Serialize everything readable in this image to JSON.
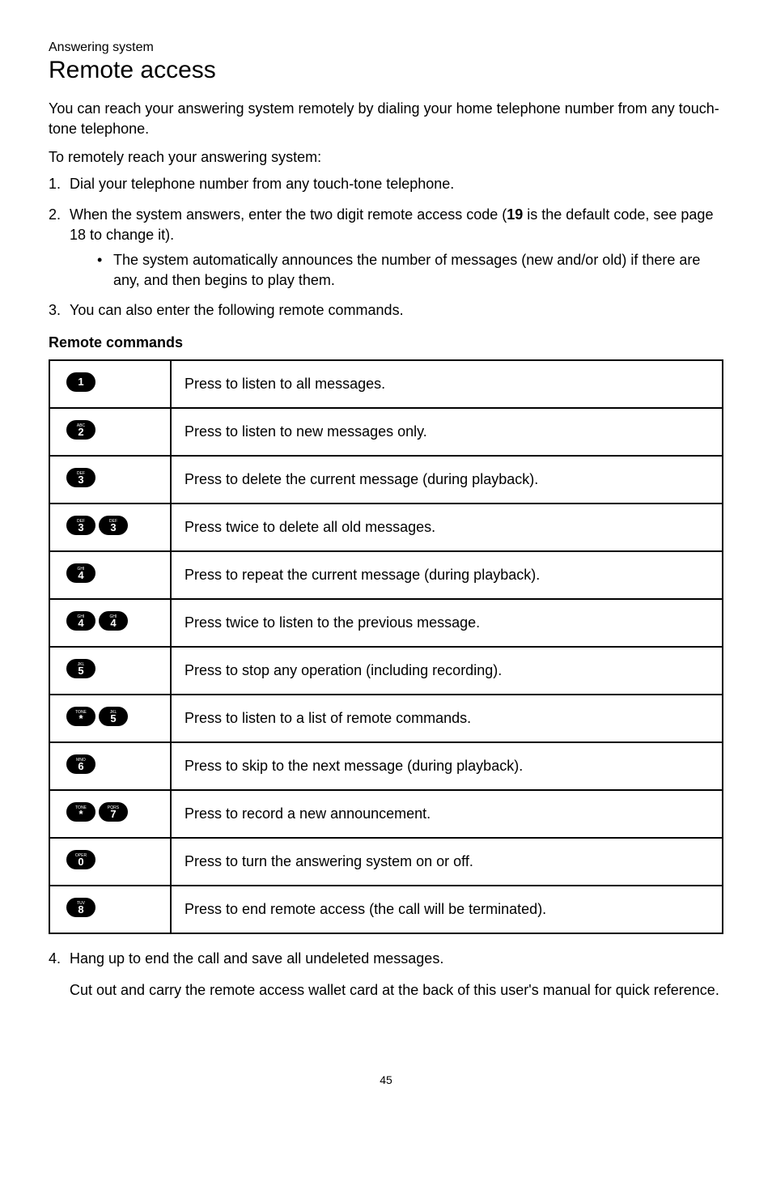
{
  "header": {
    "section_label": "Answering system",
    "title": "Remote access"
  },
  "intro": {
    "p1": "You can reach your answering system remotely by dialing your home telephone number from any touch-tone telephone.",
    "p2": "To remotely reach your answering system:"
  },
  "steps": {
    "s1": "Dial your telephone number from any touch-tone telephone.",
    "s2_a": "When the system answers, enter the two digit remote access code (",
    "s2_code": "19",
    "s2_b": " is the default code, see page 18 to change it).",
    "s2_bullet": "The system automatically announces the number of messages (new and/or old) if there are any, and then begins to play them.",
    "s3": "You can also enter the following remote commands."
  },
  "table_heading": "Remote commands",
  "table": {
    "rows": [
      {
        "keys": [
          {
            "sup": "",
            "num": "1"
          }
        ],
        "desc": "Press to listen to all messages."
      },
      {
        "keys": [
          {
            "sup": "ABC",
            "num": "2"
          }
        ],
        "desc": "Press to listen to new messages only."
      },
      {
        "keys": [
          {
            "sup": "DEF",
            "num": "3"
          }
        ],
        "desc": "Press to delete the current message (during playback)."
      },
      {
        "keys": [
          {
            "sup": "DEF",
            "num": "3"
          },
          {
            "sup": "DEF",
            "num": "3"
          }
        ],
        "desc": "Press twice to delete all old messages."
      },
      {
        "keys": [
          {
            "sup": "GHI",
            "num": "4"
          }
        ],
        "desc": "Press to repeat the current message (during playback)."
      },
      {
        "keys": [
          {
            "sup": "GHI",
            "num": "4"
          },
          {
            "sup": "GHI",
            "num": "4"
          }
        ],
        "desc": "Press twice to listen to the previous message."
      },
      {
        "keys": [
          {
            "sup": "JKL",
            "num": "5"
          }
        ],
        "desc": "Press to stop any operation (including recording)."
      },
      {
        "keys": [
          {
            "sup": "TONE",
            "num": "*"
          },
          {
            "sup": "JKL",
            "num": "5"
          }
        ],
        "desc": "Press to listen to a list of remote commands."
      },
      {
        "keys": [
          {
            "sup": "MNO",
            "num": "6"
          }
        ],
        "desc": "Press to skip to the next message (during playback)."
      },
      {
        "keys": [
          {
            "sup": "TONE",
            "num": "*"
          },
          {
            "sup": "PQRS",
            "num": "7"
          }
        ],
        "desc": "Press to record a new announcement."
      },
      {
        "keys": [
          {
            "sup": "OPER",
            "num": "0"
          }
        ],
        "desc": "Press to turn the answering system on or off."
      },
      {
        "keys": [
          {
            "sup": "TUV",
            "num": "8"
          }
        ],
        "desc": "Press to end remote access (the call will be terminated)."
      }
    ]
  },
  "after": {
    "s4_num": "4.",
    "s4": "Hang up to end the call and save all undeleted messages.",
    "note": "Cut out and carry the remote access wallet card at the back of this user's manual for quick reference."
  },
  "page_num": "45"
}
